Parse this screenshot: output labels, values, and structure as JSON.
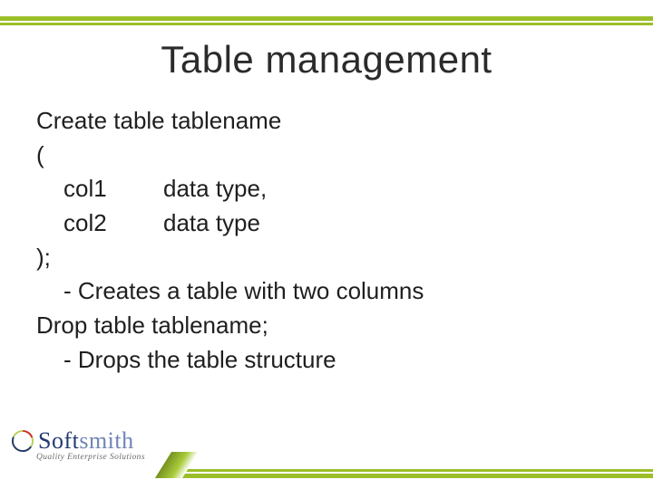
{
  "title": "Table management",
  "body": {
    "line1": "Create table tablename",
    "line2": "(",
    "col1_name": "col1",
    "col1_type": "data type,",
    "col2_name": "col2",
    "col2_type": "data type",
    "line5": ");",
    "bullet1": "- Creates a table with two columns",
    "line7": "Drop table tablename;",
    "bullet2": "- Drops the table structure"
  },
  "logo": {
    "brand_dark": "Soft",
    "brand_light": "smith",
    "tagline": "Quality Enterprise Solutions"
  }
}
